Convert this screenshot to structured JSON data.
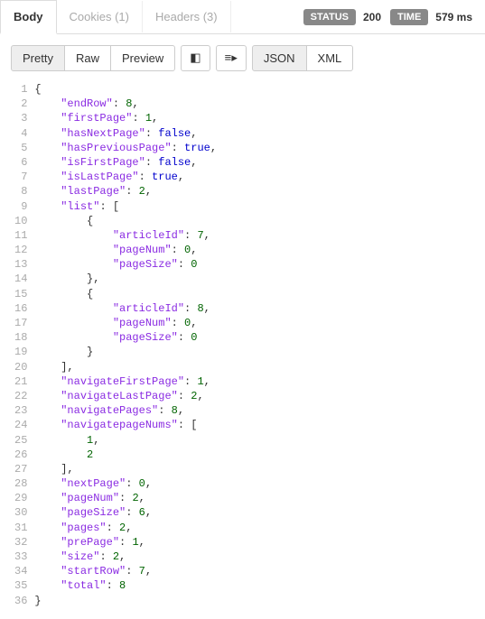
{
  "tabs": {
    "body": "Body",
    "cookies": "Cookies (1)",
    "headers": "Headers (3)"
  },
  "status": {
    "label": "STATUS",
    "value": "200"
  },
  "time": {
    "label": "TIME",
    "value": "579 ms"
  },
  "toolbar": {
    "pretty": "Pretty",
    "raw": "Raw",
    "preview": "Preview",
    "json": "JSON",
    "xml": "XML"
  },
  "response_body": {
    "endRow": 8,
    "firstPage": 1,
    "hasNextPage": false,
    "hasPreviousPage": true,
    "isFirstPage": false,
    "isLastPage": true,
    "lastPage": 2,
    "list": [
      {
        "articleId": 7,
        "pageNum": 0,
        "pageSize": 0
      },
      {
        "articleId": 8,
        "pageNum": 0,
        "pageSize": 0
      }
    ],
    "navigateFirstPage": 1,
    "navigateLastPage": 2,
    "navigatePages": 8,
    "navigatepageNums": [
      1,
      2
    ],
    "nextPage": 0,
    "pageNum": 2,
    "pageSize": 6,
    "pages": 2,
    "prePage": 1,
    "size": 2,
    "startRow": 7,
    "total": 8
  },
  "code_lines": [
    [
      [
        "punct",
        "{"
      ]
    ],
    [
      [
        "indent",
        1
      ],
      [
        "key",
        "\"endRow\""
      ],
      [
        "punct",
        ": "
      ],
      [
        "num",
        "8"
      ],
      [
        "punct",
        ","
      ]
    ],
    [
      [
        "indent",
        1
      ],
      [
        "key",
        "\"firstPage\""
      ],
      [
        "punct",
        ": "
      ],
      [
        "num",
        "1"
      ],
      [
        "punct",
        ","
      ]
    ],
    [
      [
        "indent",
        1
      ],
      [
        "key",
        "\"hasNextPage\""
      ],
      [
        "punct",
        ": "
      ],
      [
        "bool",
        "false"
      ],
      [
        "punct",
        ","
      ]
    ],
    [
      [
        "indent",
        1
      ],
      [
        "key",
        "\"hasPreviousPage\""
      ],
      [
        "punct",
        ": "
      ],
      [
        "bool",
        "true"
      ],
      [
        "punct",
        ","
      ]
    ],
    [
      [
        "indent",
        1
      ],
      [
        "key",
        "\"isFirstPage\""
      ],
      [
        "punct",
        ": "
      ],
      [
        "bool",
        "false"
      ],
      [
        "punct",
        ","
      ]
    ],
    [
      [
        "indent",
        1
      ],
      [
        "key",
        "\"isLastPage\""
      ],
      [
        "punct",
        ": "
      ],
      [
        "bool",
        "true"
      ],
      [
        "punct",
        ","
      ]
    ],
    [
      [
        "indent",
        1
      ],
      [
        "key",
        "\"lastPage\""
      ],
      [
        "punct",
        ": "
      ],
      [
        "num",
        "2"
      ],
      [
        "punct",
        ","
      ]
    ],
    [
      [
        "indent",
        1
      ],
      [
        "key",
        "\"list\""
      ],
      [
        "punct",
        ": ["
      ]
    ],
    [
      [
        "indent",
        2
      ],
      [
        "punct",
        "{"
      ]
    ],
    [
      [
        "indent",
        3
      ],
      [
        "key",
        "\"articleId\""
      ],
      [
        "punct",
        ": "
      ],
      [
        "num",
        "7"
      ],
      [
        "punct",
        ","
      ]
    ],
    [
      [
        "indent",
        3
      ],
      [
        "key",
        "\"pageNum\""
      ],
      [
        "punct",
        ": "
      ],
      [
        "num",
        "0"
      ],
      [
        "punct",
        ","
      ]
    ],
    [
      [
        "indent",
        3
      ],
      [
        "key",
        "\"pageSize\""
      ],
      [
        "punct",
        ": "
      ],
      [
        "num",
        "0"
      ]
    ],
    [
      [
        "indent",
        2
      ],
      [
        "punct",
        "},"
      ]
    ],
    [
      [
        "indent",
        2
      ],
      [
        "punct",
        "{"
      ]
    ],
    [
      [
        "indent",
        3
      ],
      [
        "key",
        "\"articleId\""
      ],
      [
        "punct",
        ": "
      ],
      [
        "num",
        "8"
      ],
      [
        "punct",
        ","
      ]
    ],
    [
      [
        "indent",
        3
      ],
      [
        "key",
        "\"pageNum\""
      ],
      [
        "punct",
        ": "
      ],
      [
        "num",
        "0"
      ],
      [
        "punct",
        ","
      ]
    ],
    [
      [
        "indent",
        3
      ],
      [
        "key",
        "\"pageSize\""
      ],
      [
        "punct",
        ": "
      ],
      [
        "num",
        "0"
      ]
    ],
    [
      [
        "indent",
        2
      ],
      [
        "punct",
        "}"
      ]
    ],
    [
      [
        "indent",
        1
      ],
      [
        "punct",
        "],"
      ]
    ],
    [
      [
        "indent",
        1
      ],
      [
        "key",
        "\"navigateFirstPage\""
      ],
      [
        "punct",
        ": "
      ],
      [
        "num",
        "1"
      ],
      [
        "punct",
        ","
      ]
    ],
    [
      [
        "indent",
        1
      ],
      [
        "key",
        "\"navigateLastPage\""
      ],
      [
        "punct",
        ": "
      ],
      [
        "num",
        "2"
      ],
      [
        "punct",
        ","
      ]
    ],
    [
      [
        "indent",
        1
      ],
      [
        "key",
        "\"navigatePages\""
      ],
      [
        "punct",
        ": "
      ],
      [
        "num",
        "8"
      ],
      [
        "punct",
        ","
      ]
    ],
    [
      [
        "indent",
        1
      ],
      [
        "key",
        "\"navigatepageNums\""
      ],
      [
        "punct",
        ": ["
      ]
    ],
    [
      [
        "indent",
        2
      ],
      [
        "num",
        "1"
      ],
      [
        "punct",
        ","
      ]
    ],
    [
      [
        "indent",
        2
      ],
      [
        "num",
        "2"
      ]
    ],
    [
      [
        "indent",
        1
      ],
      [
        "punct",
        "],"
      ]
    ],
    [
      [
        "indent",
        1
      ],
      [
        "key",
        "\"nextPage\""
      ],
      [
        "punct",
        ": "
      ],
      [
        "num",
        "0"
      ],
      [
        "punct",
        ","
      ]
    ],
    [
      [
        "indent",
        1
      ],
      [
        "key",
        "\"pageNum\""
      ],
      [
        "punct",
        ": "
      ],
      [
        "num",
        "2"
      ],
      [
        "punct",
        ","
      ]
    ],
    [
      [
        "indent",
        1
      ],
      [
        "key",
        "\"pageSize\""
      ],
      [
        "punct",
        ": "
      ],
      [
        "num",
        "6"
      ],
      [
        "punct",
        ","
      ]
    ],
    [
      [
        "indent",
        1
      ],
      [
        "key",
        "\"pages\""
      ],
      [
        "punct",
        ": "
      ],
      [
        "num",
        "2"
      ],
      [
        "punct",
        ","
      ]
    ],
    [
      [
        "indent",
        1
      ],
      [
        "key",
        "\"prePage\""
      ],
      [
        "punct",
        ": "
      ],
      [
        "num",
        "1"
      ],
      [
        "punct",
        ","
      ]
    ],
    [
      [
        "indent",
        1
      ],
      [
        "key",
        "\"size\""
      ],
      [
        "punct",
        ": "
      ],
      [
        "num",
        "2"
      ],
      [
        "punct",
        ","
      ]
    ],
    [
      [
        "indent",
        1
      ],
      [
        "key",
        "\"startRow\""
      ],
      [
        "punct",
        ": "
      ],
      [
        "num",
        "7"
      ],
      [
        "punct",
        ","
      ]
    ],
    [
      [
        "indent",
        1
      ],
      [
        "key",
        "\"total\""
      ],
      [
        "punct",
        ": "
      ],
      [
        "num",
        "8"
      ]
    ],
    [
      [
        "punct",
        "}"
      ]
    ]
  ]
}
